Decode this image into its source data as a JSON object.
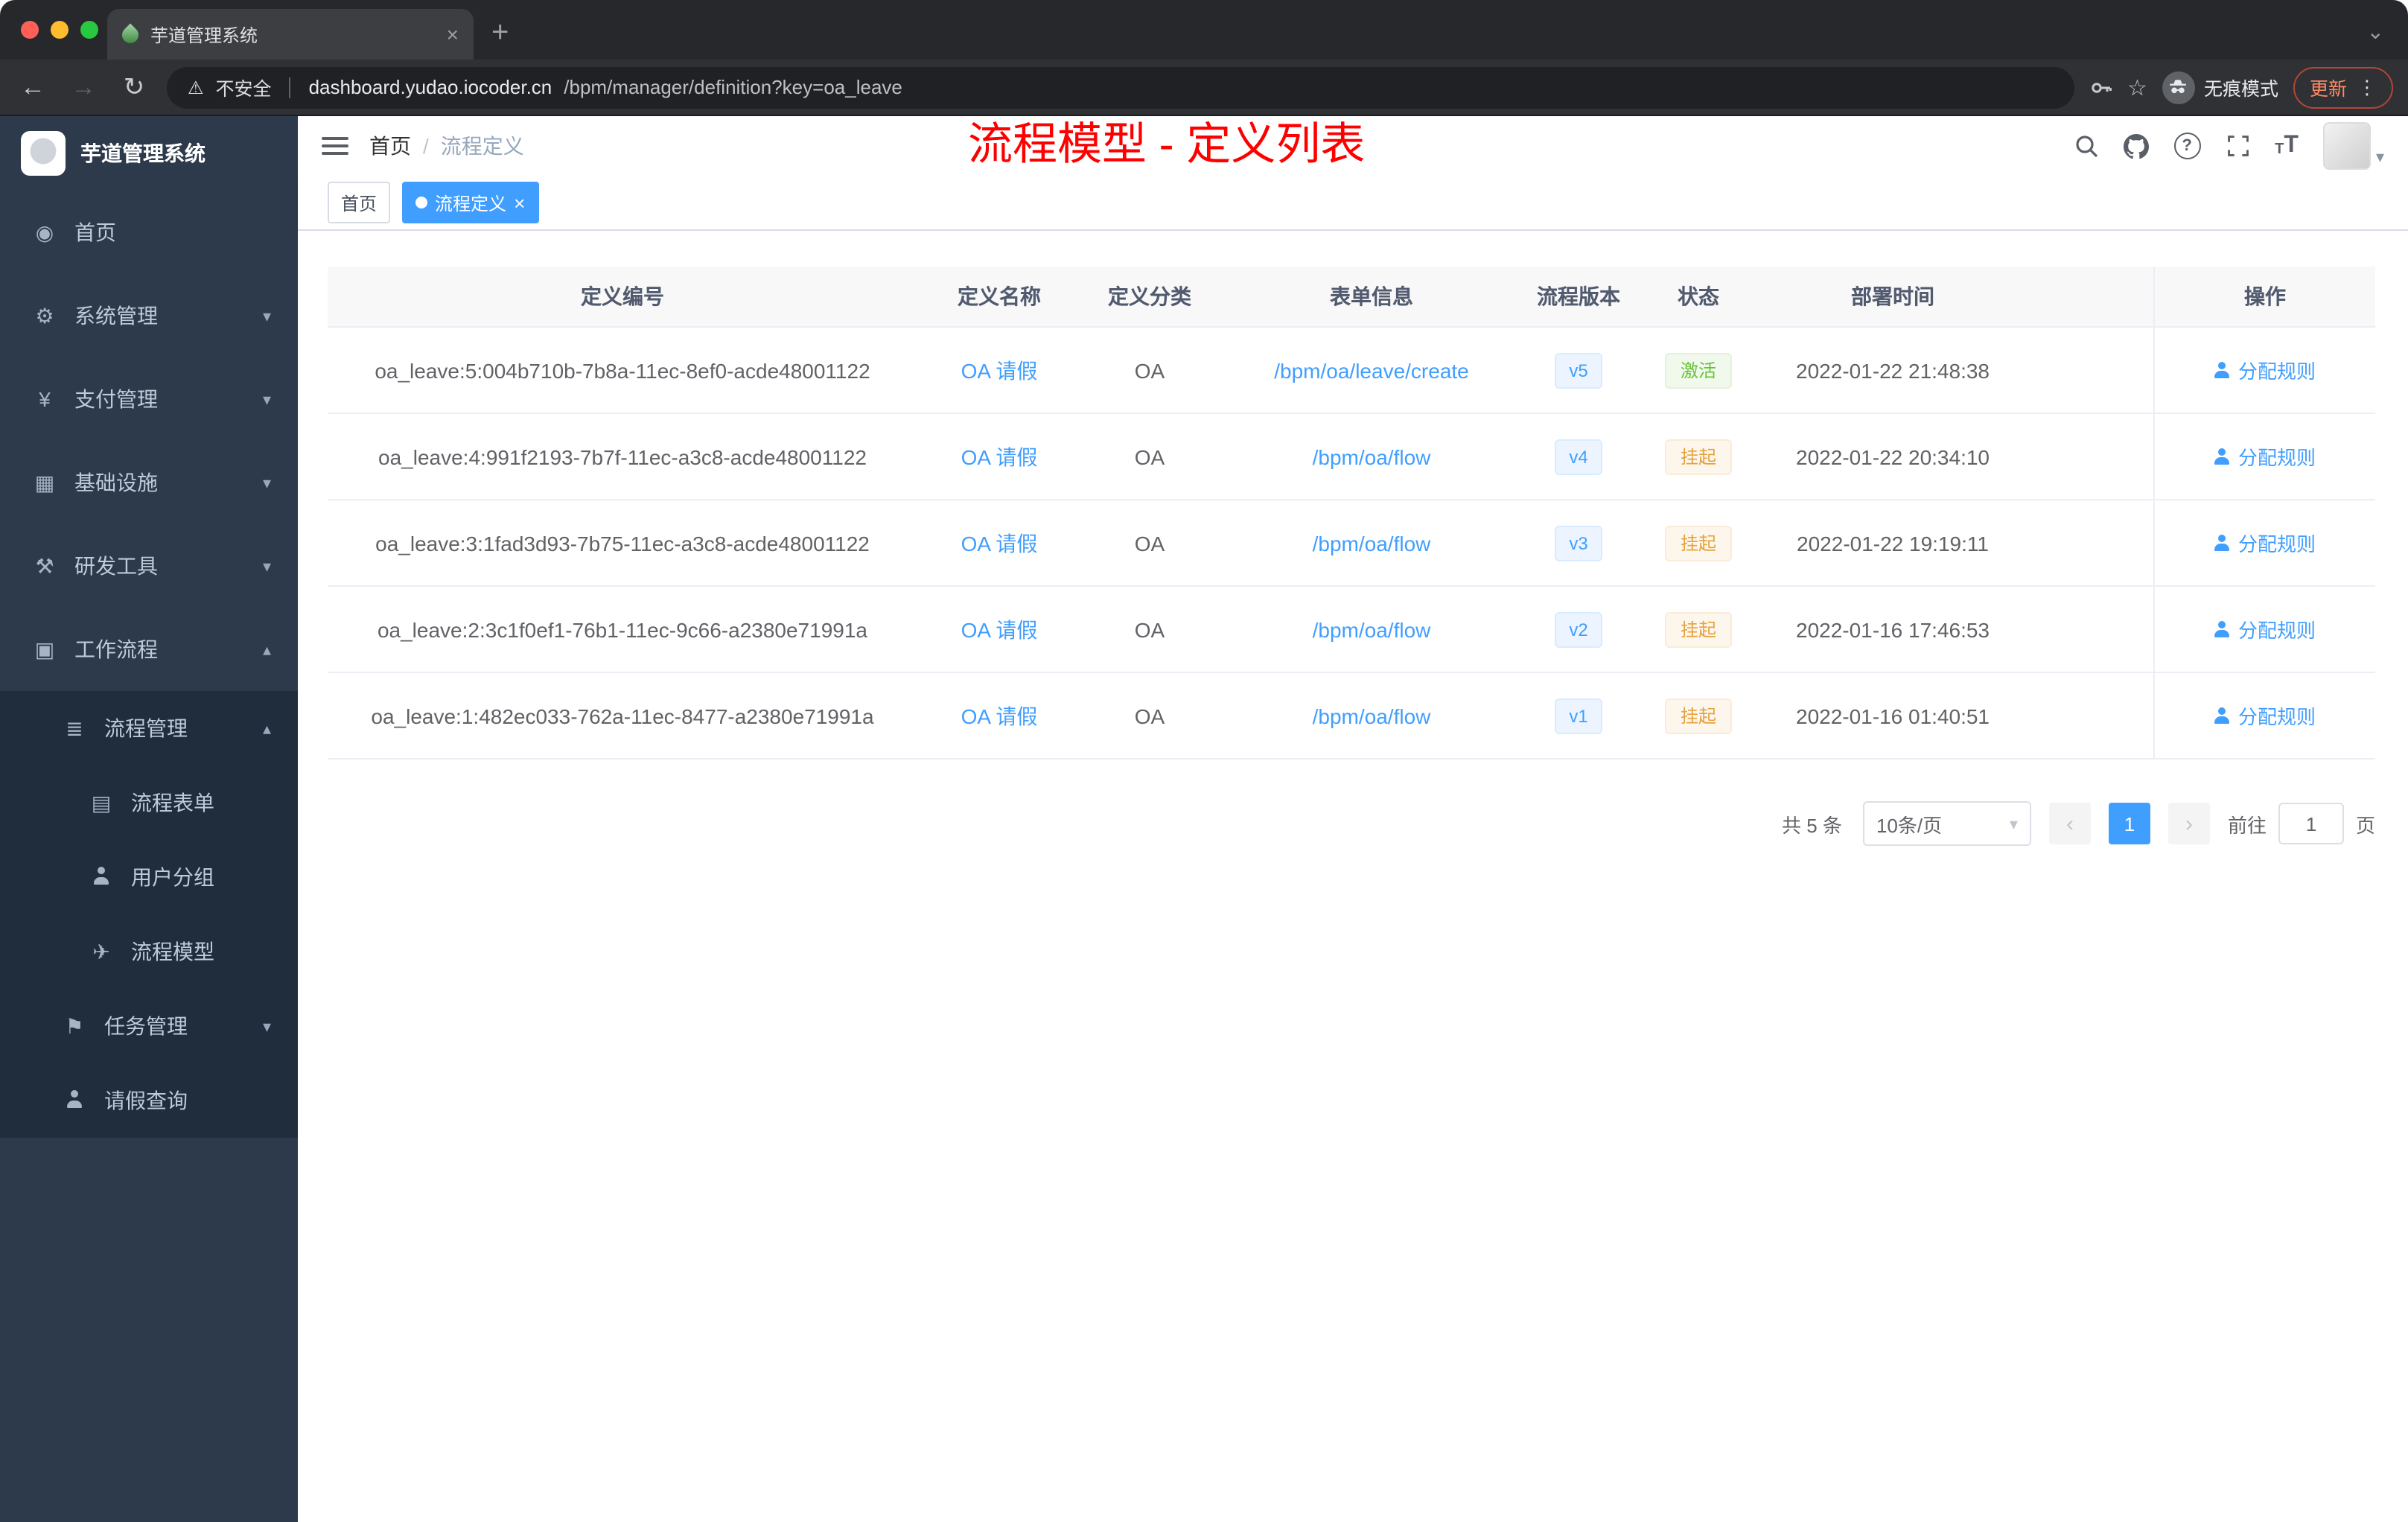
{
  "browser": {
    "tab": {
      "title": "芋道管理系统",
      "close": "×",
      "new_tab": "+"
    },
    "address": {
      "security_label": "不安全",
      "host": "dashboard.yudao.iocoder.cn",
      "path": "/bpm/manager/definition?key=oa_leave",
      "incognito_label": "无痕模式",
      "update_label": "更新"
    }
  },
  "sidebar": {
    "logo_title": "芋道管理系统",
    "menu": [
      {
        "label": "首页",
        "icon": "dashboard-icon",
        "level": 1,
        "chevron": "",
        "submenu": false
      },
      {
        "label": "系统管理",
        "icon": "gear-icon",
        "level": 1,
        "chevron": "down",
        "submenu": false
      },
      {
        "label": "支付管理",
        "icon": "yen-icon",
        "level": 1,
        "chevron": "down",
        "submenu": false
      },
      {
        "label": "基础设施",
        "icon": "infra-icon",
        "level": 1,
        "chevron": "down",
        "submenu": false
      },
      {
        "label": "研发工具",
        "icon": "tools-icon",
        "level": 1,
        "chevron": "down",
        "submenu": false
      },
      {
        "label": "工作流程",
        "icon": "workflow-icon",
        "level": 1,
        "chevron": "up",
        "submenu": false
      },
      {
        "label": "流程管理",
        "icon": "process-icon",
        "level": 2,
        "chevron": "up",
        "submenu": true
      },
      {
        "label": "流程表单",
        "icon": "form-icon",
        "level": 3,
        "chevron": "",
        "submenu": true
      },
      {
        "label": "用户分组",
        "icon": "group-icon",
        "level": 3,
        "chevron": "",
        "submenu": true
      },
      {
        "label": "流程模型",
        "icon": "model-icon",
        "level": 3,
        "chevron": "",
        "submenu": true
      },
      {
        "label": "任务管理",
        "icon": "task-icon",
        "level": 2,
        "chevron": "down",
        "submenu": true
      },
      {
        "label": "请假查询",
        "icon": "person-icon",
        "level": 2,
        "chevron": "",
        "submenu": true
      }
    ]
  },
  "header": {
    "breadcrumb": {
      "home": "首页",
      "separator": "/",
      "current": "流程定义"
    },
    "annotation": "流程模型 - 定义列表"
  },
  "tags": [
    {
      "label": "首页"
    },
    {
      "label": "流程定义"
    }
  ],
  "table": {
    "columns": [
      "定义编号",
      "定义名称",
      "定义分类",
      "表单信息",
      "流程版本",
      "状态",
      "部署时间",
      "操作"
    ],
    "rows": [
      {
        "id": "oa_leave:5:004b710b-7b8a-11ec-8ef0-acde48001122",
        "name": "OA 请假",
        "category": "OA",
        "form": "/bpm/oa/leave/create",
        "version": "v5",
        "status": "激活",
        "status_type": "success",
        "deploy_time": "2022-01-22 21:48:38",
        "action": "分配规则"
      },
      {
        "id": "oa_leave:4:991f2193-7b7f-11ec-a3c8-acde48001122",
        "name": "OA 请假",
        "category": "OA",
        "form": "/bpm/oa/flow",
        "version": "v4",
        "status": "挂起",
        "status_type": "warning",
        "deploy_time": "2022-01-22 20:34:10",
        "action": "分配规则"
      },
      {
        "id": "oa_leave:3:1fad3d93-7b75-11ec-a3c8-acde48001122",
        "name": "OA 请假",
        "category": "OA",
        "form": "/bpm/oa/flow",
        "version": "v3",
        "status": "挂起",
        "status_type": "warning",
        "deploy_time": "2022-01-22 19:19:11",
        "action": "分配规则"
      },
      {
        "id": "oa_leave:2:3c1f0ef1-76b1-11ec-9c66-a2380e71991a",
        "name": "OA 请假",
        "category": "OA",
        "form": "/bpm/oa/flow",
        "version": "v2",
        "status": "挂起",
        "status_type": "warning",
        "deploy_time": "2022-01-16 17:46:53",
        "action": "分配规则"
      },
      {
        "id": "oa_leave:1:482ec033-762a-11ec-8477-a2380e71991a",
        "name": "OA 请假",
        "category": "OA",
        "form": "/bpm/oa/flow",
        "version": "v1",
        "status": "挂起",
        "status_type": "warning",
        "deploy_time": "2022-01-16 01:40:51",
        "action": "分配规则"
      }
    ]
  },
  "pagination": {
    "total": "共 5 条",
    "page_size": "10条/页",
    "prev": "‹",
    "page": "1",
    "next": "›",
    "goto_prefix": "前往",
    "goto_value": "1",
    "goto_suffix": "页"
  },
  "colors": {
    "accent": "#409eff",
    "success": "#67c23a",
    "warning": "#e6a23c",
    "annotation": "#fe0000"
  }
}
